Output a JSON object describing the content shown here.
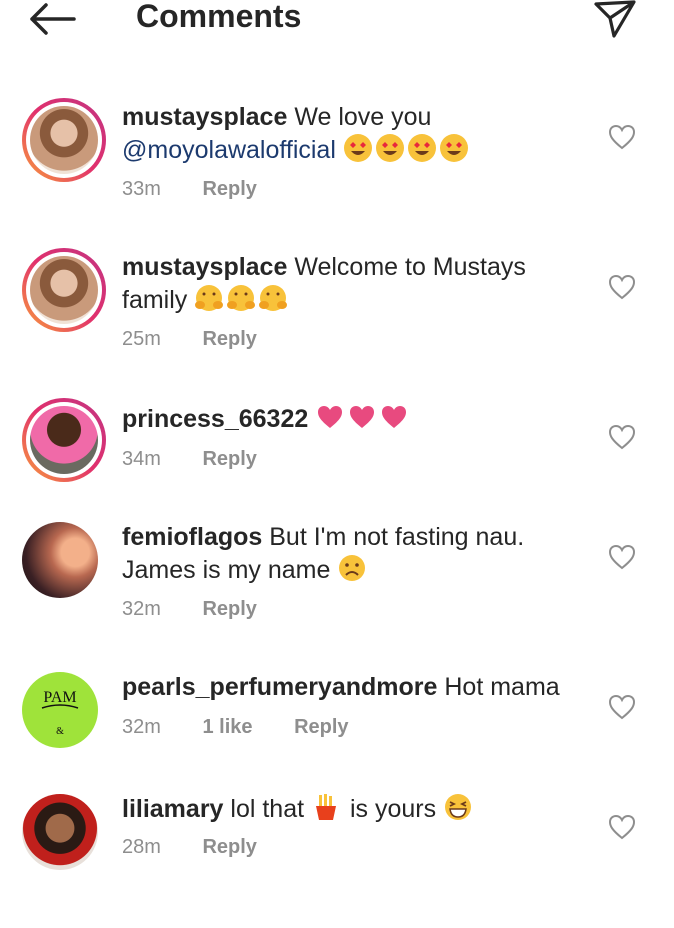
{
  "header": {
    "title": "Comments",
    "back_icon": "arrow-left-icon",
    "send_icon": "paper-plane-icon"
  },
  "comments": [
    {
      "username": "mustaysplace",
      "text": "We love you",
      "mention": "@moyolawalofficial",
      "emoji": "heart-eyes-emoji x4",
      "time": "33m",
      "reply": "Reply"
    },
    {
      "username": "mustaysplace",
      "text": "Welcome to Mustays family",
      "emoji": "hugging-emoji x3",
      "time": "25m",
      "reply": "Reply"
    },
    {
      "username": "princess_66322",
      "text": "",
      "emoji": "pink-heart-emoji x3",
      "time": "34m",
      "reply": "Reply"
    },
    {
      "username": "femioflagos",
      "text": "But I'm not fasting nau. James is my name",
      "emoji": "sad-face-emoji",
      "time": "32m",
      "reply": "Reply"
    },
    {
      "username": "pearls_perfumeryandmore",
      "text": "Hot mama",
      "time": "32m",
      "likes": "1 like",
      "reply": "Reply"
    },
    {
      "username": "liliamary",
      "text_before": "lol that",
      "text_after": "is yours",
      "emoji": "fries-emoji, grinning-squint-emoji",
      "time": "28m",
      "reply": "Reply"
    }
  ],
  "colors": {
    "text": "#262626",
    "meta": "#8e8e8e",
    "mention": "#1c3a6e",
    "heart_emoji": "#e84a7f",
    "emoji_yellow": "#f8c23a"
  }
}
